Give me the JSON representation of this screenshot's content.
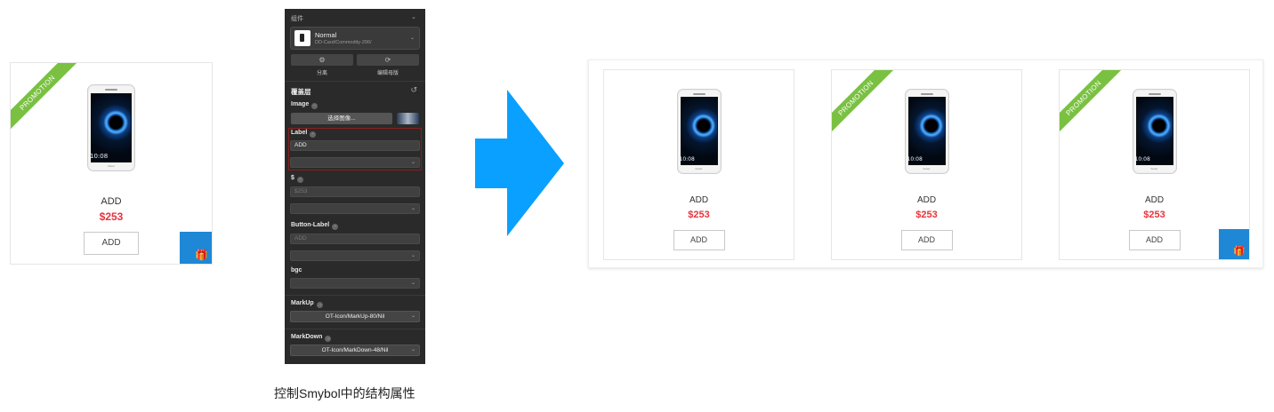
{
  "card_main": {
    "ribbon": "PROMOTION",
    "phone_time": "10:08",
    "phone_brand": "honor",
    "title": "ADD",
    "price": "$253",
    "button": "ADD",
    "gift_icon": "gift-icon"
  },
  "panel": {
    "header": "组件",
    "symbol_name": "Normal",
    "symbol_path": "DD-Card/Commodity-296/",
    "detach_label": "分离",
    "edit_master_label": "编辑母版",
    "overrides_title": "覆盖层",
    "image_label": "Image",
    "choose_image_button": "选择图像...",
    "label_label": "Label",
    "label_value": "ADD",
    "price_label": "$",
    "price_placeholder": "$253",
    "button_label_label": "Button-Label",
    "button_label_placeholder": "ADD",
    "bgc_label": "bgc",
    "markup_label": "MarkUp",
    "markup_value": "OT-Icon/MarkUp-80/Nil",
    "markdown_label": "MarkDown",
    "markdown_value": "OT-Icon/MarkDown-48/Nil"
  },
  "caption": "控制Smybol中的结构属性",
  "arrow_color": "#0aa0ff",
  "group": {
    "cards": [
      {
        "ribbon": "",
        "phone_time": "10:08",
        "phone_brand": "honor",
        "title": "ADD",
        "price": "$253",
        "button": "ADD",
        "has_corner": false
      },
      {
        "ribbon": "PROMOTION",
        "phone_time": "10:08",
        "phone_brand": "honor",
        "title": "ADD",
        "price": "$253",
        "button": "ADD",
        "has_corner": false
      },
      {
        "ribbon": "PROMOTION",
        "phone_time": "10:08",
        "phone_brand": "honor",
        "title": "ADD",
        "price": "$253",
        "button": "ADD",
        "has_corner": true
      }
    ]
  }
}
